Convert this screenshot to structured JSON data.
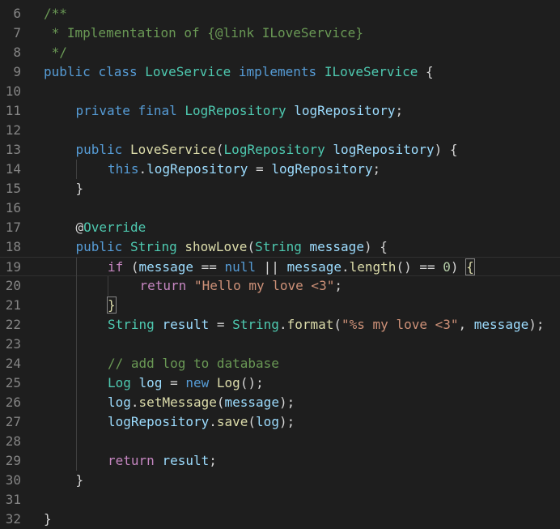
{
  "theme": {
    "background": "#1e1e1e",
    "line_number": "#858585",
    "default": "#d4d4d4",
    "keyword": "#569cd6",
    "control": "#c586c0",
    "type": "#4ec9b0",
    "function": "#dcdcaa",
    "variable": "#9cdcfe",
    "string": "#ce9178",
    "number": "#b5cea8",
    "comment": "#6a9955"
  },
  "editor": {
    "current_line": 19,
    "lines": [
      {
        "n": "6",
        "indent": 0,
        "tokens": [
          [
            "/**",
            "comment"
          ]
        ]
      },
      {
        "n": "7",
        "indent": 0,
        "tokens": [
          [
            " * Implementation of {@link ILoveService}",
            "comment"
          ]
        ]
      },
      {
        "n": "8",
        "indent": 0,
        "tokens": [
          [
            " */",
            "comment"
          ]
        ]
      },
      {
        "n": "9",
        "indent": 0,
        "tokens": [
          [
            "public",
            "keyword"
          ],
          [
            " ",
            "default"
          ],
          [
            "class",
            "keyword"
          ],
          [
            " ",
            "default"
          ],
          [
            "LoveService",
            "type"
          ],
          [
            " ",
            "default"
          ],
          [
            "implements",
            "keyword"
          ],
          [
            " ",
            "default"
          ],
          [
            "ILoveService",
            "type"
          ],
          [
            " {",
            "default"
          ]
        ]
      },
      {
        "n": "10",
        "indent": 0,
        "tokens": []
      },
      {
        "n": "11",
        "indent": 1,
        "tokens": [
          [
            "private",
            "keyword"
          ],
          [
            " ",
            "default"
          ],
          [
            "final",
            "keyword"
          ],
          [
            " ",
            "default"
          ],
          [
            "LogRepository",
            "type"
          ],
          [
            " ",
            "default"
          ],
          [
            "logRepository",
            "variable"
          ],
          [
            ";",
            "default"
          ]
        ]
      },
      {
        "n": "12",
        "indent": 0,
        "tokens": []
      },
      {
        "n": "13",
        "indent": 1,
        "tokens": [
          [
            "public",
            "keyword"
          ],
          [
            " ",
            "default"
          ],
          [
            "LoveService",
            "function"
          ],
          [
            "(",
            "default"
          ],
          [
            "LogRepository",
            "type"
          ],
          [
            " ",
            "default"
          ],
          [
            "logRepository",
            "variable"
          ],
          [
            ") {",
            "default"
          ]
        ]
      },
      {
        "n": "14",
        "indent": 2,
        "tokens": [
          [
            "this",
            "keyword"
          ],
          [
            ".",
            "default"
          ],
          [
            "logRepository",
            "variable"
          ],
          [
            " = ",
            "default"
          ],
          [
            "logRepository",
            "variable"
          ],
          [
            ";",
            "default"
          ]
        ]
      },
      {
        "n": "15",
        "indent": 1,
        "tokens": [
          [
            "}",
            "default"
          ]
        ]
      },
      {
        "n": "16",
        "indent": 0,
        "tokens": []
      },
      {
        "n": "17",
        "indent": 1,
        "tokens": [
          [
            "@",
            "default"
          ],
          [
            "Override",
            "type"
          ]
        ]
      },
      {
        "n": "18",
        "indent": 1,
        "tokens": [
          [
            "public",
            "keyword"
          ],
          [
            " ",
            "default"
          ],
          [
            "String",
            "type"
          ],
          [
            " ",
            "default"
          ],
          [
            "showLove",
            "function"
          ],
          [
            "(",
            "default"
          ],
          [
            "String",
            "type"
          ],
          [
            " ",
            "default"
          ],
          [
            "message",
            "variable"
          ],
          [
            ") {",
            "default"
          ]
        ]
      },
      {
        "n": "19",
        "indent": 2,
        "tokens": [
          [
            "if",
            "control"
          ],
          [
            " (",
            "default"
          ],
          [
            "message",
            "variable"
          ],
          [
            " == ",
            "default"
          ],
          [
            "null",
            "keyword"
          ],
          [
            " || ",
            "default"
          ],
          [
            "message",
            "variable"
          ],
          [
            ".",
            "default"
          ],
          [
            "length",
            "function"
          ],
          [
            "() == ",
            "default"
          ],
          [
            "0",
            "number"
          ],
          [
            ") ",
            "default"
          ],
          [
            "{",
            "bracket"
          ]
        ]
      },
      {
        "n": "20",
        "indent": 3,
        "tokens": [
          [
            "return",
            "control"
          ],
          [
            " ",
            "default"
          ],
          [
            "\"Hello my love <3\"",
            "string"
          ],
          [
            ";",
            "default"
          ]
        ]
      },
      {
        "n": "21",
        "indent": 2,
        "tokens": [
          [
            "}",
            "bracket"
          ]
        ]
      },
      {
        "n": "22",
        "indent": 2,
        "tokens": [
          [
            "String",
            "type"
          ],
          [
            " ",
            "default"
          ],
          [
            "result",
            "variable"
          ],
          [
            " = ",
            "default"
          ],
          [
            "String",
            "type"
          ],
          [
            ".",
            "default"
          ],
          [
            "format",
            "function"
          ],
          [
            "(",
            "default"
          ],
          [
            "\"%s my love <3\"",
            "string"
          ],
          [
            ", ",
            "default"
          ],
          [
            "message",
            "variable"
          ],
          [
            ");",
            "default"
          ]
        ]
      },
      {
        "n": "23",
        "indent": 0,
        "tokens": []
      },
      {
        "n": "24",
        "indent": 2,
        "tokens": [
          [
            "// add log to database",
            "comment"
          ]
        ]
      },
      {
        "n": "25",
        "indent": 2,
        "tokens": [
          [
            "Log",
            "type"
          ],
          [
            " ",
            "default"
          ],
          [
            "log",
            "variable"
          ],
          [
            " = ",
            "default"
          ],
          [
            "new",
            "keyword"
          ],
          [
            " ",
            "default"
          ],
          [
            "Log",
            "function"
          ],
          [
            "();",
            "default"
          ]
        ]
      },
      {
        "n": "26",
        "indent": 2,
        "tokens": [
          [
            "log",
            "variable"
          ],
          [
            ".",
            "default"
          ],
          [
            "setMessage",
            "function"
          ],
          [
            "(",
            "default"
          ],
          [
            "message",
            "variable"
          ],
          [
            ");",
            "default"
          ]
        ]
      },
      {
        "n": "27",
        "indent": 2,
        "tokens": [
          [
            "logRepository",
            "variable"
          ],
          [
            ".",
            "default"
          ],
          [
            "save",
            "function"
          ],
          [
            "(",
            "default"
          ],
          [
            "log",
            "variable"
          ],
          [
            ");",
            "default"
          ]
        ]
      },
      {
        "n": "28",
        "indent": 0,
        "tokens": []
      },
      {
        "n": "29",
        "indent": 2,
        "tokens": [
          [
            "return",
            "control"
          ],
          [
            " ",
            "default"
          ],
          [
            "result",
            "variable"
          ],
          [
            ";",
            "default"
          ]
        ]
      },
      {
        "n": "30",
        "indent": 1,
        "tokens": [
          [
            "}",
            "default"
          ]
        ]
      },
      {
        "n": "31",
        "indent": 0,
        "tokens": []
      },
      {
        "n": "32",
        "indent": 0,
        "tokens": [
          [
            "}",
            "default"
          ]
        ]
      }
    ]
  }
}
